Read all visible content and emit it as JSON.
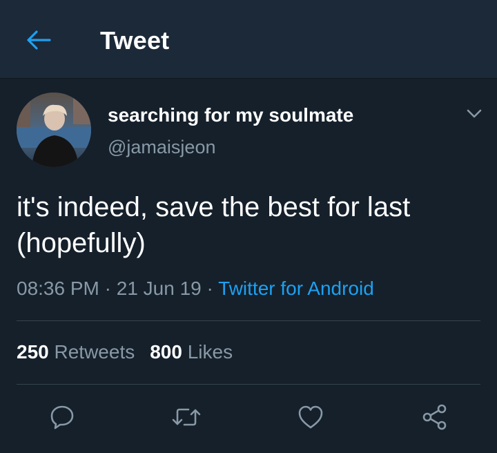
{
  "header": {
    "title": "Tweet",
    "back_icon": "arrow-left-icon",
    "accent_color": "#1da1f2"
  },
  "tweet": {
    "display_name": "searching for my soulmate",
    "handle": "@jamaisjeon",
    "text_line1": "it's indeed, save the best for last",
    "text_line2": "(hopefully)",
    "time": "08:36 PM",
    "date": "21 Jun 19",
    "separator": "·",
    "source": "Twitter for Android",
    "retweets_count": "250",
    "retweets_label": "Retweets",
    "likes_count": "800",
    "likes_label": "Likes"
  },
  "actions": [
    "reply-icon",
    "retweet-icon",
    "like-icon",
    "share-icon"
  ],
  "colors": {
    "background": "#15202b",
    "header_bg": "#1c2938",
    "secondary_text": "#8899a6",
    "divider": "#38444d"
  }
}
